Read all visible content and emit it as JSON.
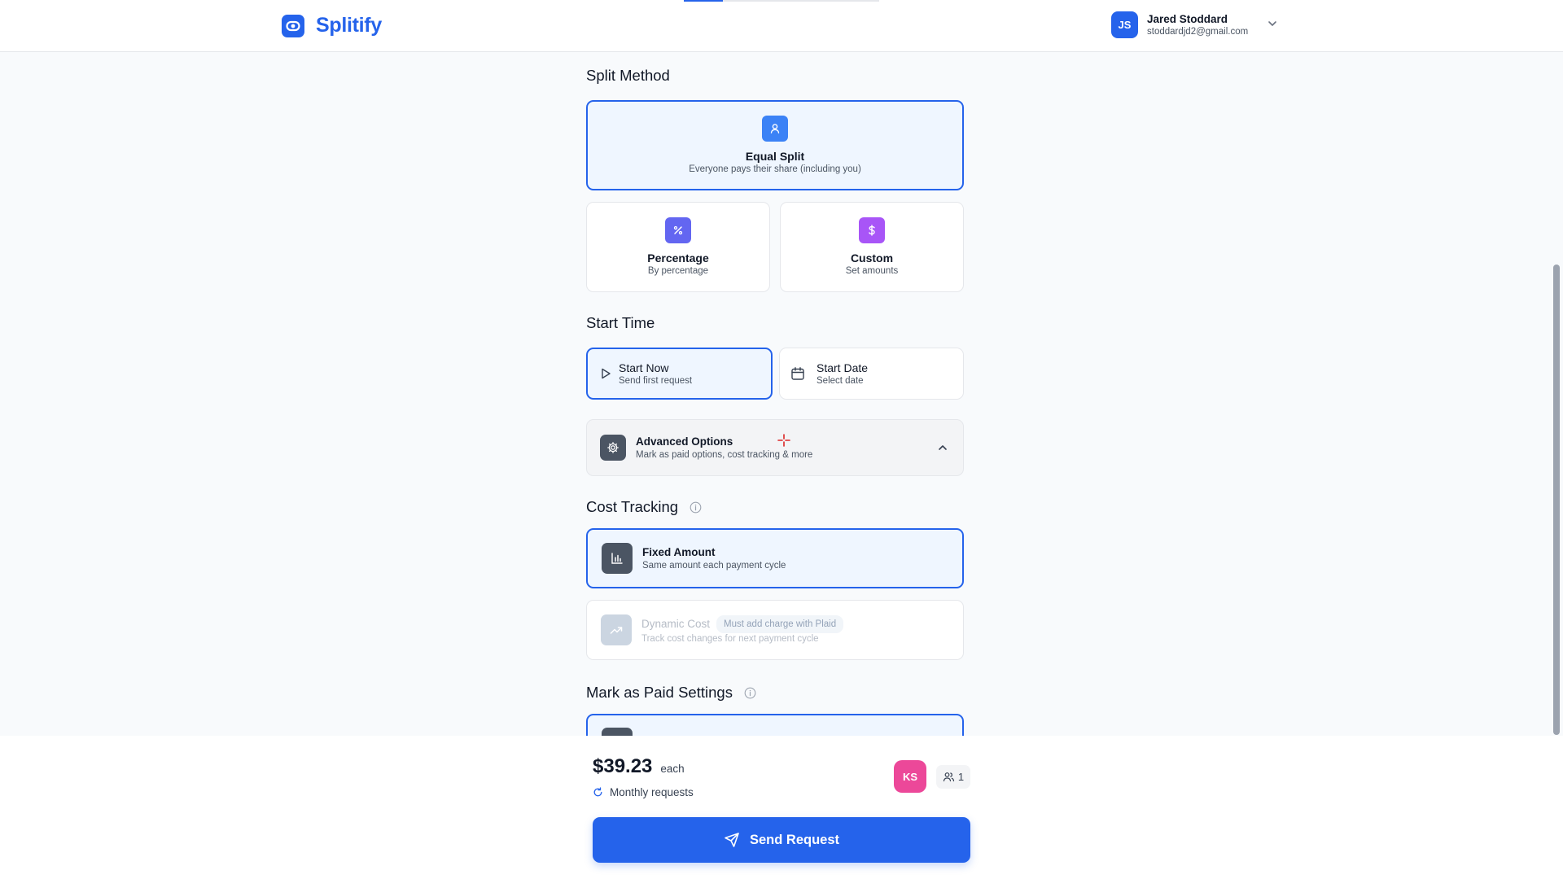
{
  "app": {
    "name": "Splitify"
  },
  "progress": {
    "fraction": 0.2
  },
  "user": {
    "initials": "JS",
    "name": "Jared Stoddard",
    "email": "stoddardjd2@gmail.com"
  },
  "split_method": {
    "title": "Split Method",
    "options": [
      {
        "title": "Equal Split",
        "subtitle": "Everyone pays their share (including you)",
        "icon": "user-icon",
        "selected": true
      },
      {
        "title": "Percentage",
        "subtitle": "By percentage",
        "icon": "percent-icon",
        "selected": false
      },
      {
        "title": "Custom",
        "subtitle": "Set amounts",
        "icon": "dollar-icon",
        "selected": false
      }
    ]
  },
  "start_time": {
    "title": "Start Time",
    "options": [
      {
        "title": "Start Now",
        "subtitle": "Send first request",
        "icon": "play-icon",
        "selected": true
      },
      {
        "title": "Start Date",
        "subtitle": "Select date",
        "icon": "calendar-icon",
        "selected": false
      }
    ]
  },
  "advanced": {
    "title": "Advanced Options",
    "subtitle": "Mark as paid options, cost tracking & more",
    "expanded": true
  },
  "cost_tracking": {
    "title": "Cost Tracking",
    "options": [
      {
        "title": "Fixed Amount",
        "subtitle": "Same amount each payment cycle",
        "selected": true
      },
      {
        "title": "Dynamic Cost",
        "badge": "Must add charge with Plaid",
        "subtitle": "Track cost changes for next payment cycle",
        "disabled": true
      }
    ]
  },
  "mark_paid": {
    "title": "Mark as Paid Settings"
  },
  "footer": {
    "amount": "$39.23",
    "each": "each",
    "frequency": "Monthly requests",
    "member_initials": "KS",
    "member_count": "1",
    "send_label": "Send Request"
  },
  "colors": {
    "accent": "#2563eb",
    "member": "#ec4899",
    "percent_tile": "#6366f1",
    "custom_tile": "#a855f7"
  }
}
